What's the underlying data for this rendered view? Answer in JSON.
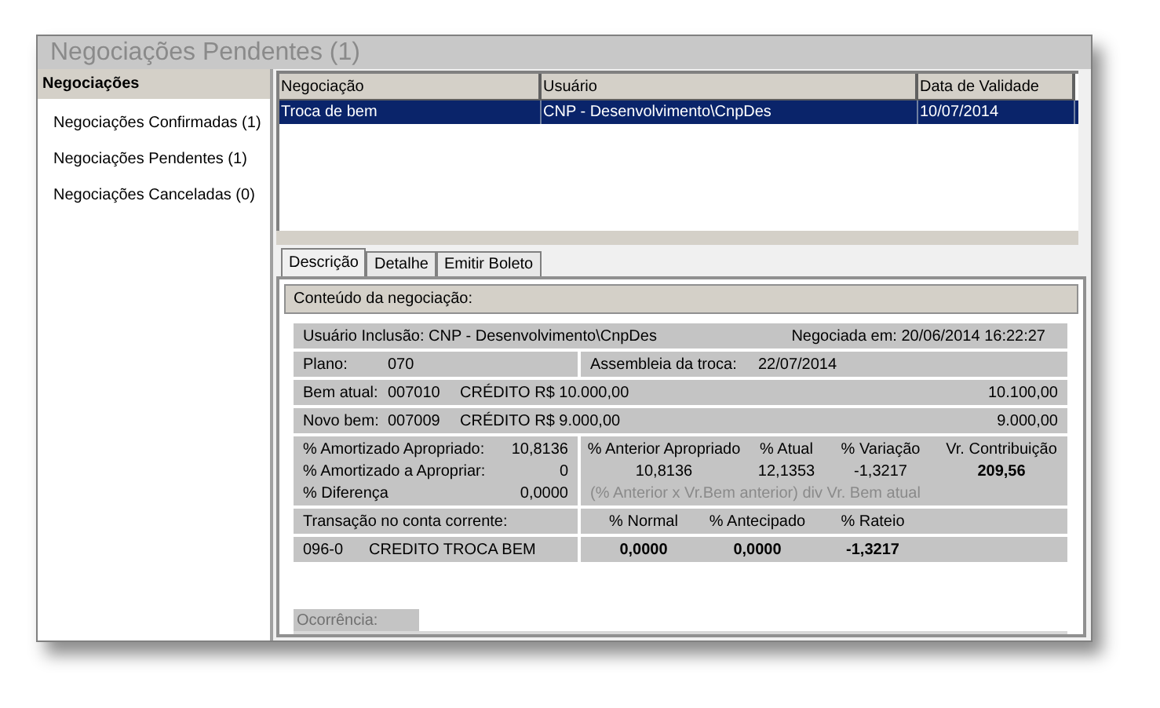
{
  "window": {
    "title": "Negociações Pendentes (1)"
  },
  "sidebar": {
    "header": "Negociações",
    "items": [
      {
        "label": "Negociações Confirmadas (1)"
      },
      {
        "label": "Negociações Pendentes (1)"
      },
      {
        "label": "Negociações Canceladas (0)"
      }
    ]
  },
  "table": {
    "columns": [
      "Negociação",
      "Usuário",
      "Data de Validade"
    ],
    "rows": [
      {
        "cells": [
          "Troca de bem",
          "CNP - Desenvolvimento\\CnpDes",
          "10/07/2014"
        ],
        "selected": true
      }
    ]
  },
  "tabs": [
    {
      "label": "Descrição",
      "selected": true
    },
    {
      "label": "Detalhe",
      "selected": false
    },
    {
      "label": "Emitir Boleto",
      "selected": false
    }
  ],
  "details": {
    "section_title": "Conteúdo da negociação:",
    "user": "Usuário Inclusão: CNP - Desenvolvimento\\CnpDes",
    "negotiated": "Negociada em: 20/06/2014 16:22:27",
    "plan": {
      "label": "Plano:",
      "value": "070",
      "assembly_label": "Assembleia da troca:",
      "assembly_value": "22/07/2014"
    },
    "assets": [
      {
        "label": "Bem atual:",
        "code": "007010",
        "credit": "CRÉDITO R$ 10.000,00",
        "amount": "10.100,00"
      },
      {
        "label": "Novo bem:",
        "code": "007009",
        "credit": "CRÉDITO R$ 9.000,00",
        "amount": "9.000,00"
      }
    ],
    "amortization": [
      {
        "label": "% Amortizado Apropriado:",
        "value": "10,8136"
      },
      {
        "label": "% Amortizado a Apropriar:",
        "value": "0"
      },
      {
        "label": "% Diferença",
        "value": "0,0000"
      }
    ],
    "comparison": {
      "headers": [
        "% Anterior Apropriado",
        "% Atual",
        "% Variação",
        "Vr. Contribuição"
      ],
      "values": [
        "10,8136",
        "12,1353",
        "-1,3217",
        "209,56"
      ],
      "note": "(% Anterior x Vr.Bem anterior) div Vr. Bem atual"
    },
    "transaction": {
      "label": "Transação no conta corrente:",
      "headers": [
        "% Normal",
        "% Antecipado",
        "% Rateio"
      ],
      "code": "096-0",
      "description": "CREDITO TROCA BEM",
      "values": [
        "0,0000",
        "0,0000",
        "-1,3217"
      ]
    },
    "occurrence": "Ocorrência:"
  }
}
